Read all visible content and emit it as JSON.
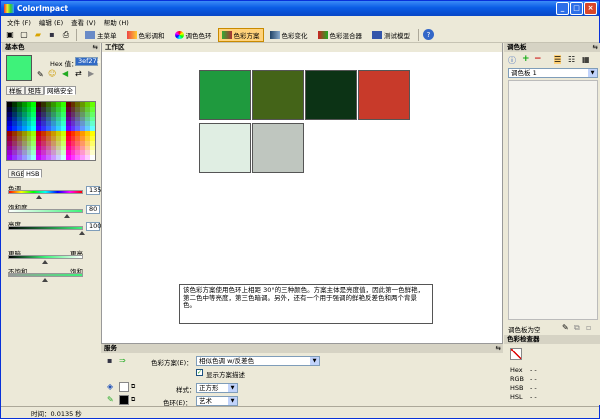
{
  "window": {
    "title": "ColorImpact",
    "minimize": "_",
    "maximize": "□",
    "close": "×"
  },
  "menu": [
    "文件 (F)",
    "编辑 (E)",
    "查看 (V)",
    "帮助 (H)"
  ],
  "toolbar": {
    "tabs": [
      {
        "label": "主菜单",
        "icon": "home-icon"
      },
      {
        "label": "色彩调和",
        "icon": "harmony-icon"
      },
      {
        "label": "调色色环",
        "icon": "color-wheel-icon"
      },
      {
        "label": "色彩方案",
        "icon": "scheme-icon",
        "active": true
      },
      {
        "label": "色彩变化",
        "icon": "variation-icon"
      },
      {
        "label": "色彩混合器",
        "icon": "mixer-icon"
      },
      {
        "label": "测试模型",
        "icon": "test-model-icon"
      }
    ]
  },
  "left": {
    "title": "基本色",
    "base_color": "#3ef27a",
    "hex_label": "Hex 值：",
    "hex_value": "3ef27a",
    "tabs": [
      "样板",
      "矩阵",
      "网络安全"
    ],
    "mode_tabs": [
      "RGB",
      "HSB"
    ],
    "hue_label": "色调",
    "hue_value": "135",
    "sat_label": "饱和度",
    "sat_value": "80",
    "bri_label": "亮度",
    "bri_value": "100",
    "dark_label": "更暗",
    "dark_right": "更亮",
    "unsat_label": "不饱和",
    "unsat_right": "饱和"
  },
  "work": {
    "title": "工作区",
    "swatches": [
      "#1f9a3e",
      "#446418",
      "#0c3315",
      "#c83a2a",
      "#e0eee3",
      "#bfc6bf"
    ],
    "description": "该色彩方案使用色环上相距 30°的三种颜色。方案主体是亮度值，因此第一色鲜艳，第二色中等亮度，第三色暗调。另外，还有一个用于强调的鲜艳反差色和两个背景色。"
  },
  "right": {
    "title": "调色板",
    "palette_select": "调色板 1",
    "empty_label": "调色板为空",
    "inspector_title": "色彩检查器",
    "hex_label": "Hex",
    "hex_value": "- -",
    "rgb_label": "RGB",
    "rgb_value": "- -",
    "hsb_label": "HSB",
    "hsb_value": "- -",
    "hsl_label": "HSL",
    "hsl_value": "- -"
  },
  "bottom": {
    "title": "服务",
    "scheme_label": "色彩方案(E)：",
    "scheme_value": "相似色调 w/反差色",
    "show_desc_label": "显示方案描述",
    "style_label": "样式：",
    "style_value": "正方形",
    "wheel_label": "色环(E)：",
    "wheel_value": "艺术"
  },
  "status": {
    "time_text": "时间：0.0135 秒"
  }
}
